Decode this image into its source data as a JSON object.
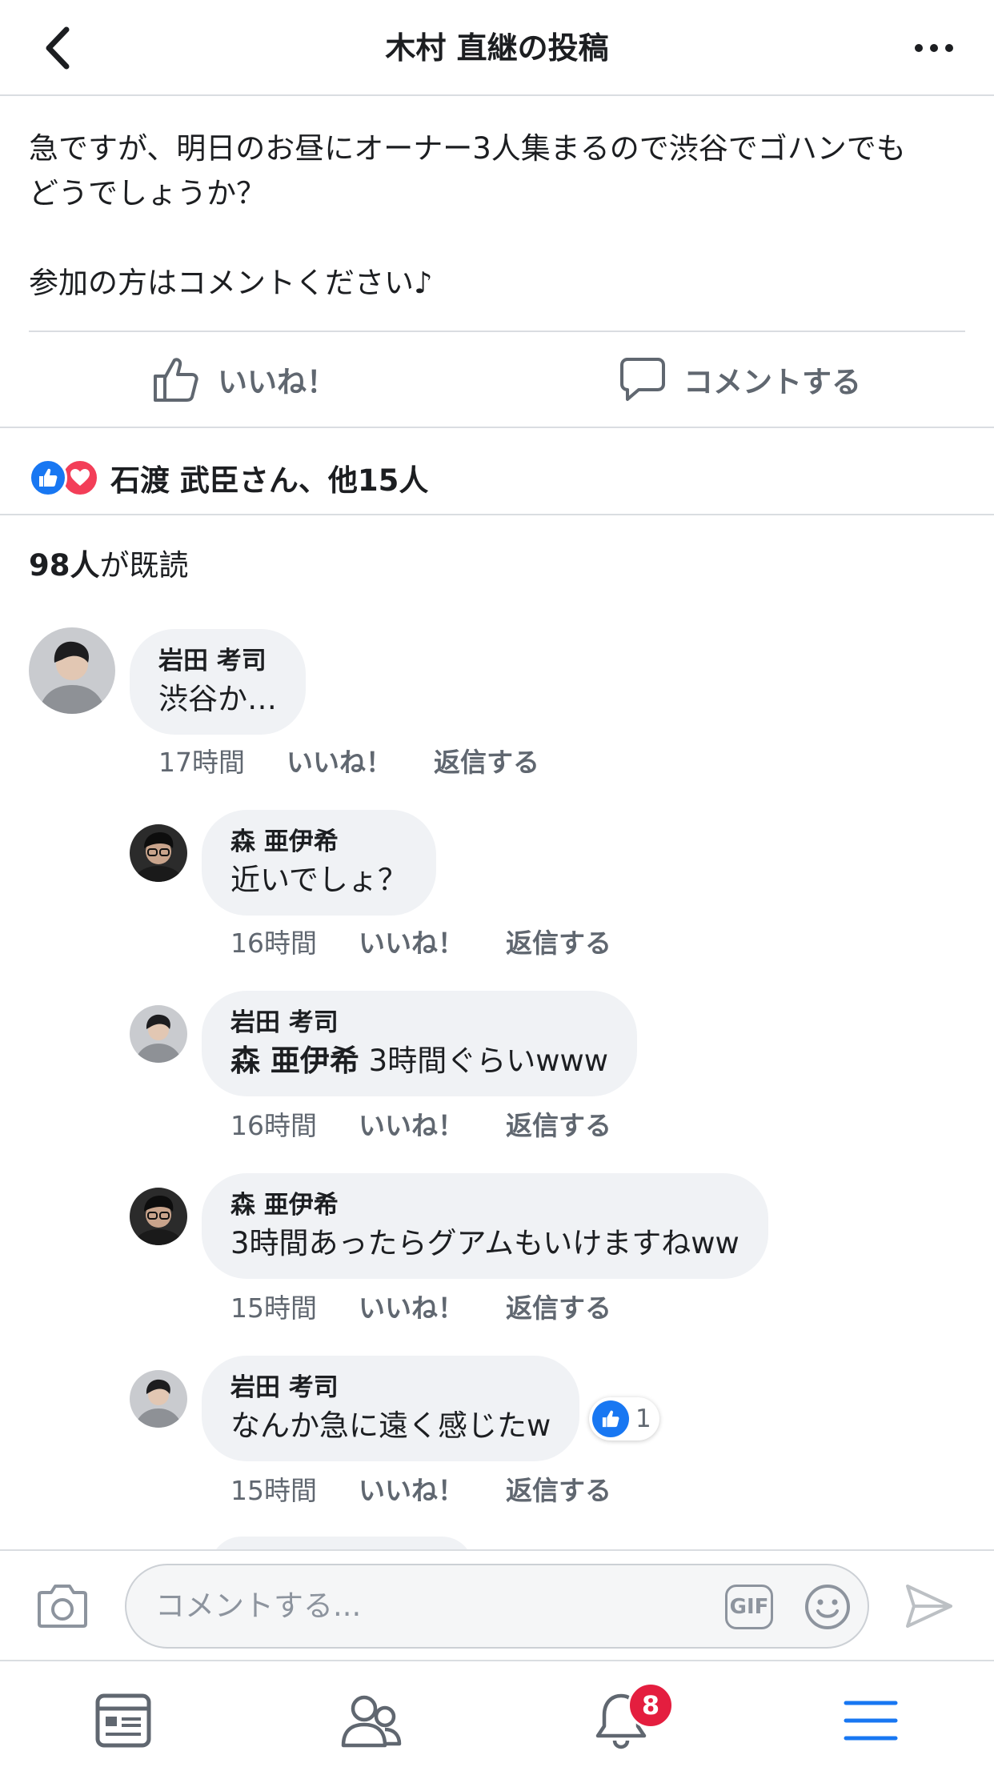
{
  "header": {
    "title": "木村 直継の投稿"
  },
  "post": {
    "text": "急ですが、明日のお昼にオーナー3人集まるので渋谷でゴハンでも\nどうでしょうか？\n\n参加の方はコメントください♪"
  },
  "actions": {
    "like_label": "いいね！",
    "comment_label": "コメントする"
  },
  "reactions": {
    "summary": "石渡 武臣さん、他15人"
  },
  "seen": {
    "count": "98人",
    "suffix": "が既読"
  },
  "comments": [
    {
      "author": "岩田 考司",
      "text": "渋谷か…",
      "time": "17時間",
      "like": "いいね！",
      "reply": "返信する"
    },
    {
      "author": "森 亜伊希",
      "text": "近いでしょ？",
      "time": "16時間",
      "like": "いいね！",
      "reply": "返信する"
    },
    {
      "author": "岩田 考司",
      "mention": "森 亜伊希",
      "text": "3時間ぐらいwww",
      "time": "16時間",
      "like": "いいね！",
      "reply": "返信する"
    },
    {
      "author": "森 亜伊希",
      "text": "3時間あったらグアムもいけますねww",
      "time": "15時間",
      "like": "いいね！",
      "reply": "返信する"
    },
    {
      "author": "岩田 考司",
      "text": "なんか急に遠く感じたw",
      "time": "15時間",
      "like": "いいね！",
      "reply": "返信する",
      "like_count": "1"
    }
  ],
  "composer": {
    "placeholder": "コメントする...",
    "gif_label": "GIF"
  },
  "tabbar": {
    "notification_count": "8"
  },
  "colors": {
    "accent": "#1877f2",
    "love": "#f33e58",
    "badge": "#e41e3f",
    "bubble": "#f0f2f5",
    "muted": "#606770"
  }
}
